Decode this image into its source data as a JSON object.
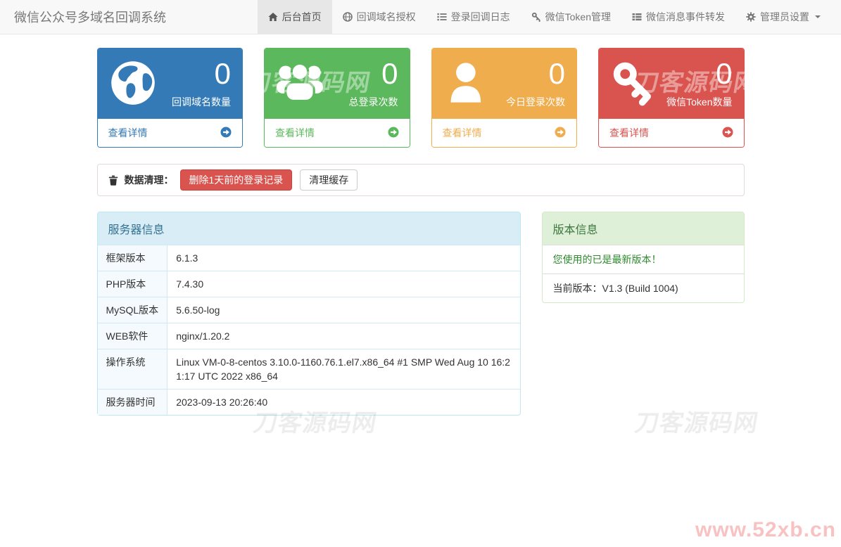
{
  "navbar": {
    "brand": "微信公众号多域名回调系统",
    "items": [
      {
        "label": "后台首页",
        "icon": "home-icon",
        "active": true
      },
      {
        "label": "回调域名授权",
        "icon": "globe-icon",
        "active": false
      },
      {
        "label": "登录回调日志",
        "icon": "list-icon",
        "active": false
      },
      {
        "label": "微信Token管理",
        "icon": "key-icon",
        "active": false
      },
      {
        "label": "微信消息事件转发",
        "icon": "th-list-icon",
        "active": false
      },
      {
        "label": "管理员设置",
        "icon": "gear-icon",
        "active": false,
        "has_dropdown": true
      }
    ]
  },
  "stats": [
    {
      "value": "0",
      "label": "回调域名数量",
      "footer_link": "查看详情",
      "icon": "globe-icon",
      "color": "#337ab7"
    },
    {
      "value": "0",
      "label": "总登录次数",
      "footer_link": "查看详情",
      "icon": "users-icon",
      "color": "#5cb85c"
    },
    {
      "value": "0",
      "label": "今日登录次数",
      "footer_link": "查看详情",
      "icon": "user-icon",
      "color": "#f0ad4e"
    },
    {
      "value": "0",
      "label": "微信Token数量",
      "footer_link": "查看详情",
      "icon": "key-icon",
      "color": "#d9534f"
    }
  ],
  "cleanup": {
    "icon": "trash-icon",
    "label": "数据清理：",
    "delete_button": "删除1天前的登录记录",
    "clear_cache_button": "清理缓存"
  },
  "server_panel": {
    "title": "服务器信息",
    "rows": [
      {
        "label": "框架版本",
        "value": "6.1.3"
      },
      {
        "label": "PHP版本",
        "value": "7.4.30"
      },
      {
        "label": "MySQL版本",
        "value": "5.6.50-log"
      },
      {
        "label": "WEB软件",
        "value": "nginx/1.20.2"
      },
      {
        "label": "操作系统",
        "value": "Linux VM-0-8-centos 3.10.0-1160.76.1.el7.x86_64 #1 SMP Wed Aug 10 16:21:17 UTC 2022 x86_64"
      },
      {
        "label": "服务器时间",
        "value": "2023-09-13 20:26:40"
      }
    ]
  },
  "version_panel": {
    "title": "版本信息",
    "latest_text": "您使用的已是最新版本！",
    "current_text": "当前版本：V1.3 (Build 1004)"
  },
  "watermarks": {
    "site_name": "刀客源码网",
    "corner_url": "www.52xb.cn"
  },
  "colors": {
    "primary": "#337ab7",
    "success": "#5cb85c",
    "warning": "#f0ad4e",
    "danger": "#d9534f",
    "navbar_bg": "#f8f8f8",
    "navbar_active_bg": "#e7e7e7",
    "info_header_bg": "#d9edf7",
    "info_header_text": "#31708f",
    "success_header_bg": "#dff0d8",
    "success_header_text": "#3c763d"
  }
}
